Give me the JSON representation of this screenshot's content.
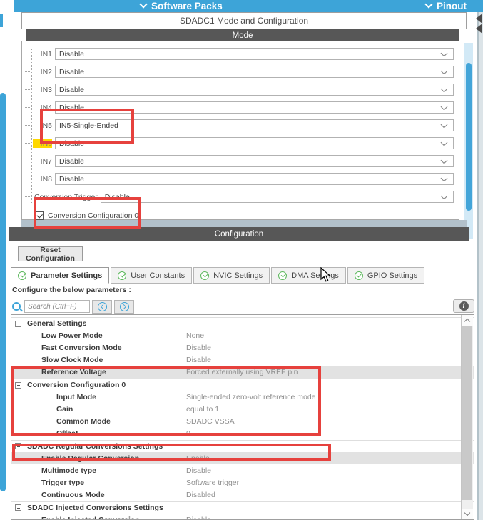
{
  "topbar": {
    "software_packs": "Software Packs",
    "pinout": "Pinout"
  },
  "panel_title": "SDADC1 Mode and Configuration",
  "mode": {
    "header": "Mode",
    "channels": [
      {
        "label": "IN1",
        "value": "Disable"
      },
      {
        "label": "IN2",
        "value": "Disable"
      },
      {
        "label": "IN3",
        "value": "Disable"
      },
      {
        "label": "IN4",
        "value": "Disable"
      },
      {
        "label": "IN5",
        "value": "IN5-Single-Ended"
      },
      {
        "label": "IN6",
        "value": "Disable",
        "highlight": true
      },
      {
        "label": "IN7",
        "value": "Disable"
      },
      {
        "label": "IN8",
        "value": "Disable"
      },
      {
        "label": "Conversion Trigger",
        "value": "Disable",
        "wide_label": true
      }
    ],
    "checkbox": {
      "label": "Conversion Configuration 0",
      "checked": true
    }
  },
  "config": {
    "header": "Configuration",
    "reset_button": "Reset Configuration",
    "tabs": [
      {
        "label": "Parameter Settings",
        "active": true
      },
      {
        "label": "User Constants"
      },
      {
        "label": "NVIC Settings"
      },
      {
        "label": "DMA Settings"
      },
      {
        "label": "GPIO Settings"
      }
    ],
    "caption": "Configure the below parameters :",
    "search_placeholder": "Search (Ctrl+F)",
    "info_icon": "i",
    "tree": [
      {
        "type": "group",
        "label": "General Settings"
      },
      {
        "type": "item",
        "label": "Low Power Mode",
        "value": "None",
        "indent": 1
      },
      {
        "type": "item",
        "label": "Fast Conversion Mode",
        "value": "Disable",
        "indent": 1
      },
      {
        "type": "item",
        "label": "Slow Clock Mode",
        "value": "Disable",
        "indent": 1
      },
      {
        "type": "item",
        "label": "Reference Voltage",
        "value": "Forced externally using VREF pin",
        "indent": 1,
        "band": true
      },
      {
        "type": "group",
        "label": "Conversion Configuration 0"
      },
      {
        "type": "item",
        "label": "Input Mode",
        "value": "Single-ended zero-volt reference mode",
        "indent": 2
      },
      {
        "type": "item",
        "label": "Gain",
        "value": "equal to 1",
        "indent": 2
      },
      {
        "type": "item",
        "label": "Common Mode",
        "value": "SDADC VSSA",
        "indent": 2
      },
      {
        "type": "item",
        "label": "Offset",
        "value": "0",
        "indent": 2
      },
      {
        "type": "group",
        "label": "SDADC Regular Conversions Settings"
      },
      {
        "type": "item",
        "label": "Enable Regular Conversion",
        "value": "Enable",
        "indent": 1,
        "band": true
      },
      {
        "type": "item",
        "label": "Multimode type",
        "value": "Disable",
        "indent": 1
      },
      {
        "type": "item",
        "label": "Trigger type",
        "value": "Software trigger",
        "indent": 1
      },
      {
        "type": "item",
        "label": "Continuous Mode",
        "value": "Disabled",
        "indent": 1
      },
      {
        "type": "group",
        "label": "SDADC Injected Conversions Settings"
      },
      {
        "type": "item",
        "label": "Enable Injected Conversion",
        "value": "Disable",
        "indent": 1
      }
    ]
  },
  "colors": {
    "accent_blue": "#3da4d8",
    "header_dark": "#575757",
    "annotation_red": "#e6413d",
    "highlight_yellow": "#ffd800",
    "tab_check_green": "#5cb85c",
    "value_grey": "#8f8f8f",
    "selected_row_grey": "#e2e2e2"
  }
}
